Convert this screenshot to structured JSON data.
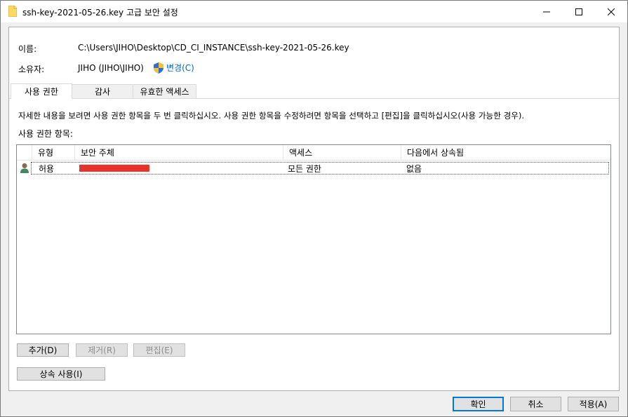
{
  "window": {
    "title": "ssh-key-2021-05-26.key 고급 보안 설정"
  },
  "info": {
    "name_label": "이름:",
    "name_value": "C:\\Users\\JIHO\\Desktop\\CD_CI_INSTANCE\\ssh-key-2021-05-26.key",
    "owner_label": "소유자:",
    "owner_value": "JIHO (JIHO\\JIHO)",
    "change_label": "변경(C)"
  },
  "tabs": [
    {
      "label": "사용 권한",
      "active": true
    },
    {
      "label": "감사",
      "active": false
    },
    {
      "label": "유효한 액세스",
      "active": false
    }
  ],
  "instructions": "자세한 내용을 보려면 사용 권한 항목을 두 번 클릭하십시오. 사용 권한 항목을 수정하려면 항목을 선택하고 [편집]을 클릭하십시오(사용 가능한 경우).",
  "entries_label": "사용 권한 항목:",
  "table": {
    "columns": [
      "유형",
      "보안 주체",
      "액세스",
      "다음에서 상속됨"
    ],
    "rows": [
      {
        "type": "허용",
        "principal": "",
        "access": "모든 권한",
        "inherited": "없음"
      }
    ]
  },
  "buttons": {
    "add": "추가(D)",
    "remove": "제거(R)",
    "edit": "편집(E)",
    "inherit": "상속 사용(I)",
    "ok": "확인",
    "cancel": "취소",
    "apply": "적용(A)"
  },
  "colors": {
    "redaction": "#e8322c",
    "link": "#0066cc"
  }
}
